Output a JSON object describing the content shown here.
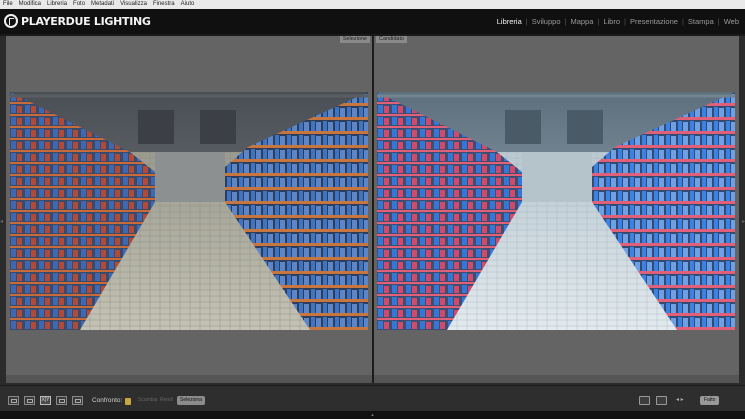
{
  "menubar": {
    "items": [
      "File",
      "Modifica",
      "Libreria",
      "Foto",
      "Metadati",
      "Visualizza",
      "Finestra",
      "Aiuto"
    ]
  },
  "identity": {
    "logo_text": "PLAYERDUE LIGHTING",
    "icon": "brand-logo-icon"
  },
  "modules": {
    "items": [
      "Libreria",
      "Sviluppo",
      "Mappa",
      "Libro",
      "Presentazione",
      "Stampa",
      "Web"
    ],
    "active": "Libreria"
  },
  "compare": {
    "left_label": "Selezione",
    "right_label": "Candidato",
    "left_image": "supermarket-aisle-original",
    "right_image": "supermarket-aisle-edited"
  },
  "toolbar": {
    "xy_label": "X|Y",
    "compare_label": "Confronto:",
    "swap_label": "Scambia",
    "make_select_label": "Rendi",
    "selection_label": "Seleziona",
    "done_label": "Fatto",
    "view_icons": [
      "grid-view-icon",
      "loupe-view-icon",
      "compare-view-icon",
      "survey-view-icon",
      "people-view-icon"
    ]
  },
  "colors": {
    "menubar_bg": "#e9e9e9",
    "topbar_bg": "#101010",
    "pane_bg": "#646464",
    "toolbar_bg": "#2e2e2e",
    "lock": "#c9a640"
  }
}
